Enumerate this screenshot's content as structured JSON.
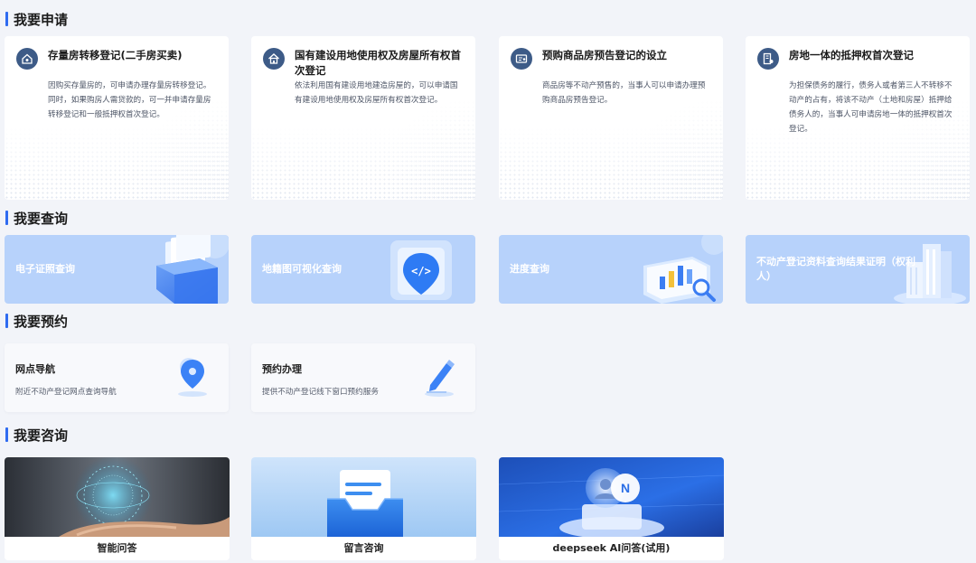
{
  "sections": {
    "apply": "我要申请",
    "query": "我要查询",
    "appointment": "我要预约",
    "consult": "我要咨询"
  },
  "apply_cards": [
    {
      "title": "存量房转移登记(二手房买卖)",
      "desc": "因购买存量房的，可申请办理存量房转移登记。同时，如果购房人需贷款的，可一并申请存量房转移登记和一般抵押权首次登记。",
      "icon": "house-key-icon"
    },
    {
      "title": "国有建设用地使用权及房屋所有权首次登记",
      "desc": "依法利用国有建设用地建造房屋的，可以申请国有建设用地使用权及房屋所有权首次登记。",
      "icon": "house-icon"
    },
    {
      "title": "预购商品房预告登记的设立",
      "desc": "商品房等不动产预售的，当事人可以申请办理预购商品房预告登记。",
      "icon": "certificate-icon"
    },
    {
      "title": "房地一体的抵押权首次登记",
      "desc": "为担保债务的履行，债务人或者第三人不转移不动产的占有，将该不动产（土地和房屋）抵押给债务人的，当事人可申请房地一体的抵押权首次登记。",
      "icon": "mortgage-icon"
    }
  ],
  "query_cards": [
    {
      "label": "电子证照查询",
      "icon": "document-folder-icon"
    },
    {
      "label": "地籍图可视化查询",
      "icon": "map-pin-code-icon"
    },
    {
      "label": "进度查询",
      "icon": "progress-chart-icon"
    },
    {
      "label": "不动产登记资料查询结果证明（权利人）",
      "icon": "buildings-icon"
    }
  ],
  "appointment_cards": [
    {
      "title": "网点导航",
      "desc": "附近不动产登记网点查询导航",
      "icon": "location-pin-icon"
    },
    {
      "title": "预约办理",
      "desc": "提供不动产登记线下窗口预约服务",
      "icon": "pen-edit-icon"
    }
  ],
  "consult_cards": [
    {
      "label": "智能问答",
      "image": "ai-hand-globe-image"
    },
    {
      "label": "留言咨询",
      "image": "mailbox-image"
    },
    {
      "label": "deepseek AI问答(试用)",
      "image": "ai-chip-image"
    }
  ],
  "colors": {
    "accent": "#2f6bf0",
    "page_bg": "#f2f4f9",
    "query_bg": "#b7d2fb",
    "apply_icon_bg": "#3d5b87"
  }
}
